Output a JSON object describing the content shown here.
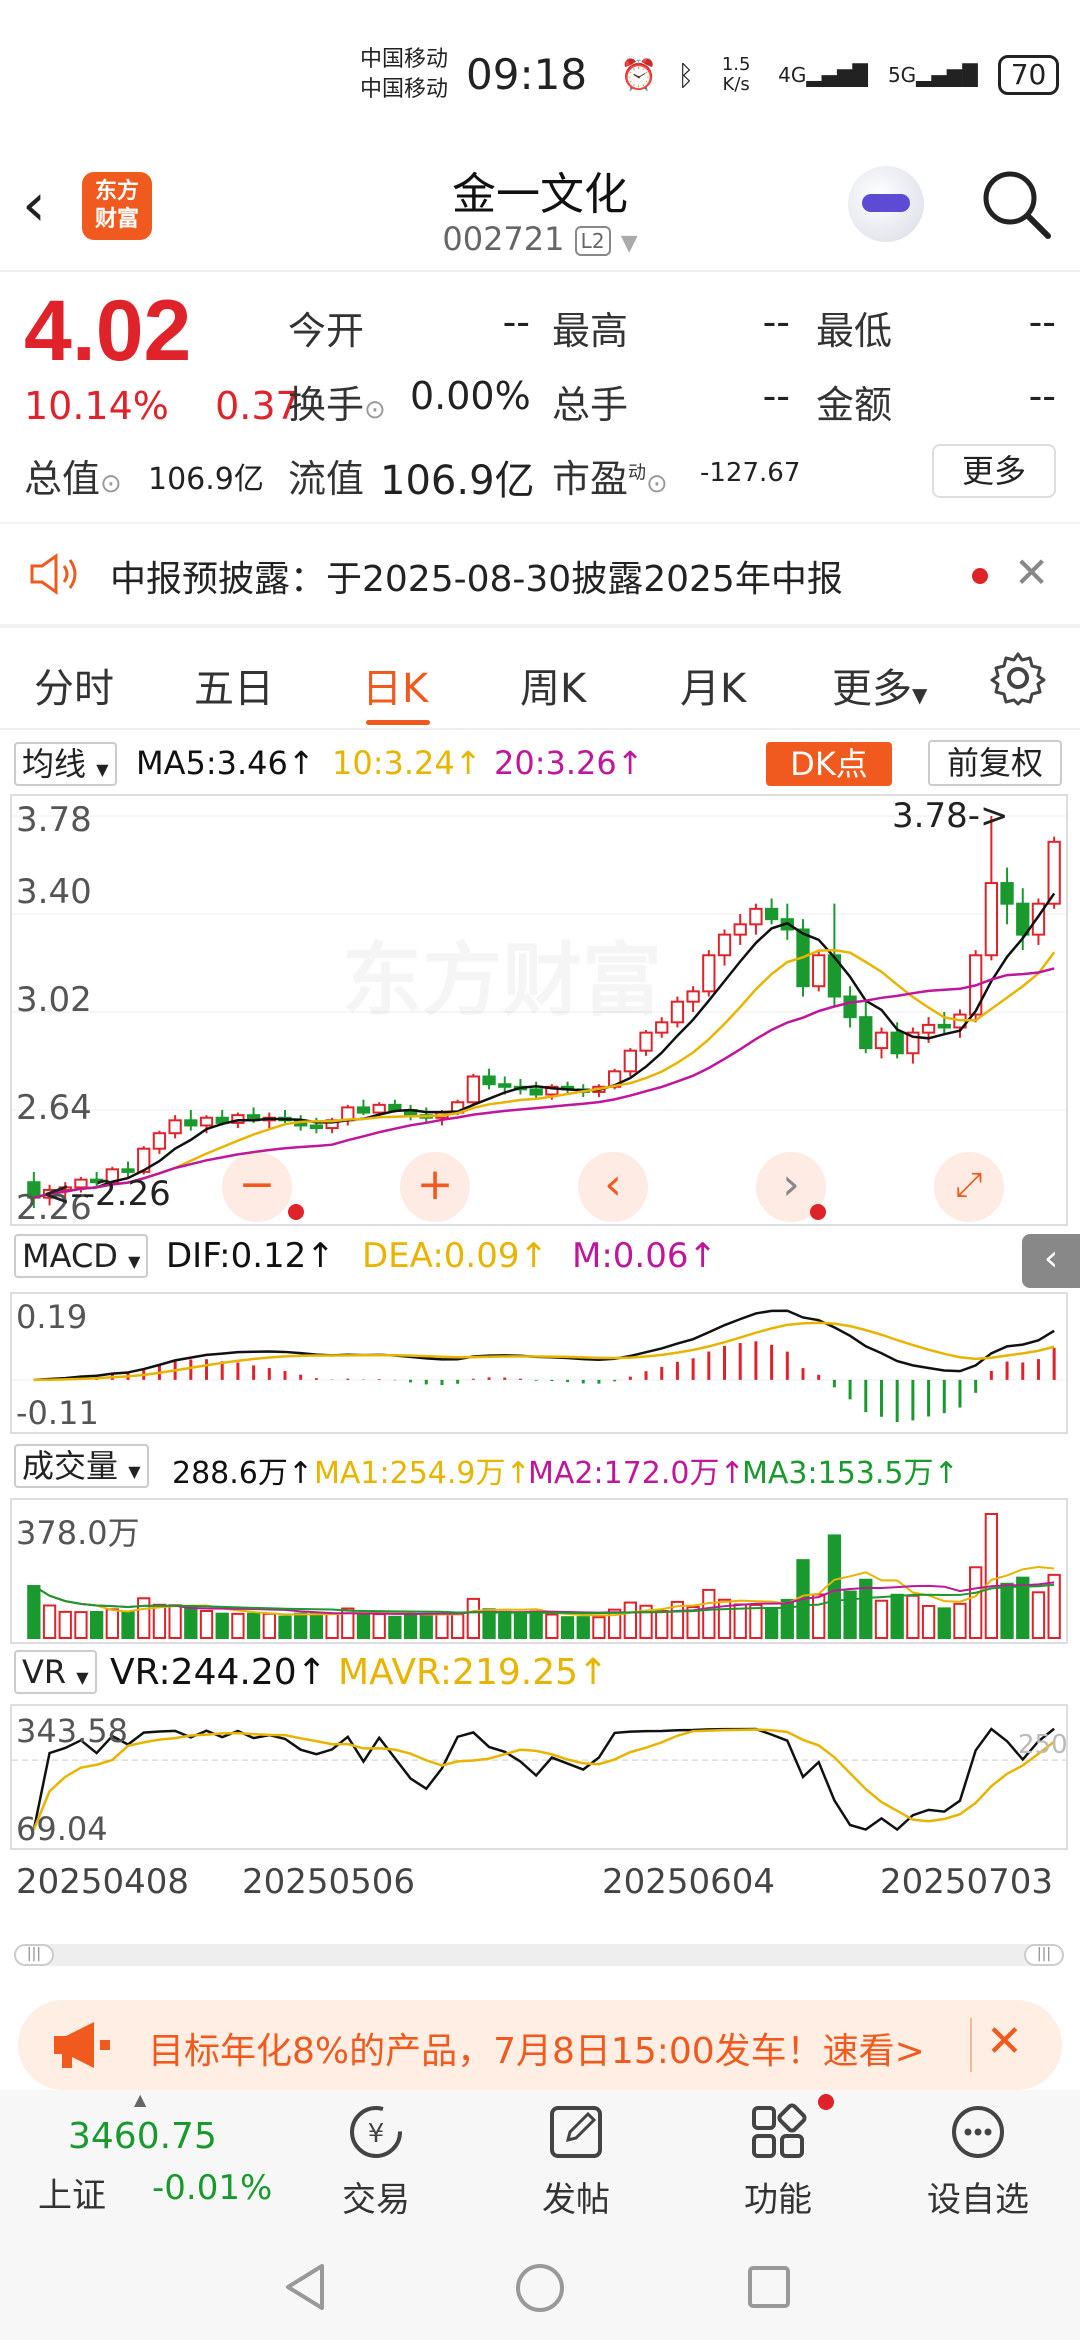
{
  "status_bar": {
    "carrier1": "中国移动",
    "carrier2": "中国移动",
    "time": "09:18",
    "net_speed": "1.5 K/s",
    "signal1": "4G",
    "signal2": "5G",
    "battery": "70"
  },
  "header": {
    "logo": "东方财富",
    "title": "金一文化",
    "code": "002721",
    "level": "L2"
  },
  "quote": {
    "price": "4.02",
    "change_pct": "10.14%",
    "change_abs": "0.37",
    "open_label": "今开",
    "open_val": "--",
    "high_label": "最高",
    "high_val": "--",
    "low_label": "最低",
    "low_val": "--",
    "turnover_label": "换手",
    "turnover_val": "0.00%",
    "volume_label": "总手",
    "volume_val": "--",
    "amount_label": "金额",
    "amount_val": "--",
    "mktcap_label": "总值",
    "mktcap_val": "106.9亿",
    "float_label": "流值",
    "float_val": "106.9亿",
    "pe_label": "市盈",
    "pe_sup": "动",
    "pe_val": "-127.67",
    "more_button": "更多"
  },
  "notice": {
    "text": "中报预披露：于2025-08-30披露2025年中报"
  },
  "tabs": [
    "分时",
    "五日",
    "日K",
    "周K",
    "月K",
    "更多"
  ],
  "active_tab": "日K",
  "kline": {
    "selector": "均线",
    "ma5": "MA5:3.46",
    "ma10": "10:3.24",
    "ma20": "20:3.26",
    "dk_button": "DK点",
    "adjust_button": "前复权",
    "watermark": "东方财富",
    "axis": [
      "3.78",
      "3.40",
      "3.02",
      "2.64",
      "2.26"
    ],
    "max_label": "3.78->",
    "min_label": "<--2.26"
  },
  "macd": {
    "selector": "MACD",
    "dif": "DIF:0.12",
    "dea": "DEA:0.09",
    "m": "M:0.06",
    "axis_top": "0.19",
    "axis_bottom": "-0.11"
  },
  "volume": {
    "selector": "成交量",
    "value": "288.6万",
    "ma1": "MA1:254.9万",
    "ma2": "MA2:172.0万",
    "ma3": "MA3:153.5万",
    "axis_top": "378.0万"
  },
  "vr": {
    "selector": "VR",
    "vr": "VR:244.20",
    "mavr": "MAVR:219.25",
    "axis_top": "343.58",
    "axis_bottom": "69.04",
    "ref_line": "250"
  },
  "dates": [
    "20250408",
    "20250506",
    "20250604",
    "20250703"
  ],
  "banner": {
    "text": "目标年化8%的产品，7月8日15:00发车！速看>"
  },
  "bottom_nav": {
    "index_value": "3460.75",
    "index_name": "上证",
    "index_change": "-0.01%",
    "items": [
      "交易",
      "发帖",
      "功能",
      "设自选"
    ]
  },
  "colors": {
    "up": "#e0232a",
    "down": "#1a9a2e",
    "accent": "#f05a1e",
    "ma5": "#111111",
    "ma10": "#e8b400",
    "ma20": "#c0169b"
  },
  "chart_data": {
    "type": "candlestick",
    "ylim": [
      2.26,
      3.78
    ],
    "ohlc": [
      [
        2.36,
        2.4,
        2.26,
        2.3
      ],
      [
        2.3,
        2.35,
        2.27,
        2.33
      ],
      [
        2.33,
        2.36,
        2.3,
        2.34
      ],
      [
        2.34,
        2.38,
        2.32,
        2.37
      ],
      [
        2.37,
        2.4,
        2.34,
        2.36
      ],
      [
        2.36,
        2.42,
        2.35,
        2.41
      ],
      [
        2.41,
        2.44,
        2.38,
        2.4
      ],
      [
        2.4,
        2.5,
        2.39,
        2.49
      ],
      [
        2.49,
        2.56,
        2.47,
        2.55
      ],
      [
        2.55,
        2.62,
        2.53,
        2.6
      ],
      [
        2.6,
        2.64,
        2.56,
        2.58
      ],
      [
        2.58,
        2.62,
        2.55,
        2.61
      ],
      [
        2.61,
        2.64,
        2.58,
        2.59
      ],
      [
        2.59,
        2.63,
        2.57,
        2.62
      ],
      [
        2.62,
        2.65,
        2.59,
        2.6
      ],
      [
        2.6,
        2.63,
        2.57,
        2.61
      ],
      [
        2.61,
        2.64,
        2.59,
        2.6
      ],
      [
        2.6,
        2.62,
        2.56,
        2.58
      ],
      [
        2.58,
        2.61,
        2.55,
        2.57
      ],
      [
        2.57,
        2.61,
        2.55,
        2.6
      ],
      [
        2.6,
        2.66,
        2.58,
        2.65
      ],
      [
        2.65,
        2.68,
        2.62,
        2.63
      ],
      [
        2.63,
        2.67,
        2.61,
        2.66
      ],
      [
        2.66,
        2.68,
        2.63,
        2.64
      ],
      [
        2.64,
        2.66,
        2.6,
        2.62
      ],
      [
        2.62,
        2.65,
        2.59,
        2.61
      ],
      [
        2.61,
        2.64,
        2.58,
        2.63
      ],
      [
        2.63,
        2.68,
        2.62,
        2.67
      ],
      [
        2.67,
        2.78,
        2.66,
        2.77
      ],
      [
        2.77,
        2.8,
        2.72,
        2.74
      ],
      [
        2.74,
        2.77,
        2.7,
        2.73
      ],
      [
        2.73,
        2.76,
        2.7,
        2.72
      ],
      [
        2.72,
        2.75,
        2.68,
        2.7
      ],
      [
        2.7,
        2.74,
        2.68,
        2.73
      ],
      [
        2.73,
        2.75,
        2.7,
        2.72
      ],
      [
        2.72,
        2.74,
        2.69,
        2.71
      ],
      [
        2.71,
        2.74,
        2.69,
        2.73
      ],
      [
        2.73,
        2.8,
        2.72,
        2.79
      ],
      [
        2.79,
        2.88,
        2.77,
        2.87
      ],
      [
        2.87,
        2.95,
        2.85,
        2.94
      ],
      [
        2.94,
        3.0,
        2.92,
        2.98
      ],
      [
        2.98,
        3.08,
        2.96,
        3.06
      ],
      [
        3.06,
        3.12,
        3.02,
        3.1
      ],
      [
        3.1,
        3.26,
        3.08,
        3.24
      ],
      [
        3.24,
        3.34,
        3.2,
        3.32
      ],
      [
        3.32,
        3.4,
        3.28,
        3.36
      ],
      [
        3.36,
        3.44,
        3.32,
        3.42
      ],
      [
        3.42,
        3.46,
        3.36,
        3.38
      ],
      [
        3.38,
        3.44,
        3.3,
        3.34
      ],
      [
        3.34,
        3.38,
        3.08,
        3.12
      ],
      [
        3.12,
        3.26,
        3.1,
        3.24
      ],
      [
        3.24,
        3.44,
        3.04,
        3.08
      ],
      [
        3.08,
        3.12,
        2.96,
        3.0
      ],
      [
        3.0,
        3.06,
        2.86,
        2.88
      ],
      [
        2.88,
        2.96,
        2.84,
        2.94
      ],
      [
        2.94,
        2.98,
        2.84,
        2.86
      ],
      [
        2.86,
        2.96,
        2.82,
        2.94
      ],
      [
        2.94,
        3.0,
        2.9,
        2.97
      ],
      [
        2.97,
        3.02,
        2.93,
        2.96
      ],
      [
        2.96,
        3.03,
        2.92,
        3.01
      ],
      [
        3.01,
        3.26,
        2.98,
        3.24
      ],
      [
        3.24,
        3.78,
        3.22,
        3.52
      ],
      [
        3.52,
        3.58,
        3.36,
        3.44
      ],
      [
        3.44,
        3.5,
        3.26,
        3.32
      ],
      [
        3.32,
        3.46,
        3.28,
        3.44
      ],
      [
        3.44,
        3.7,
        3.42,
        3.68
      ]
    ],
    "ma5_latest": 3.46,
    "ma10_latest": 3.24,
    "ma20_latest": 3.26
  }
}
